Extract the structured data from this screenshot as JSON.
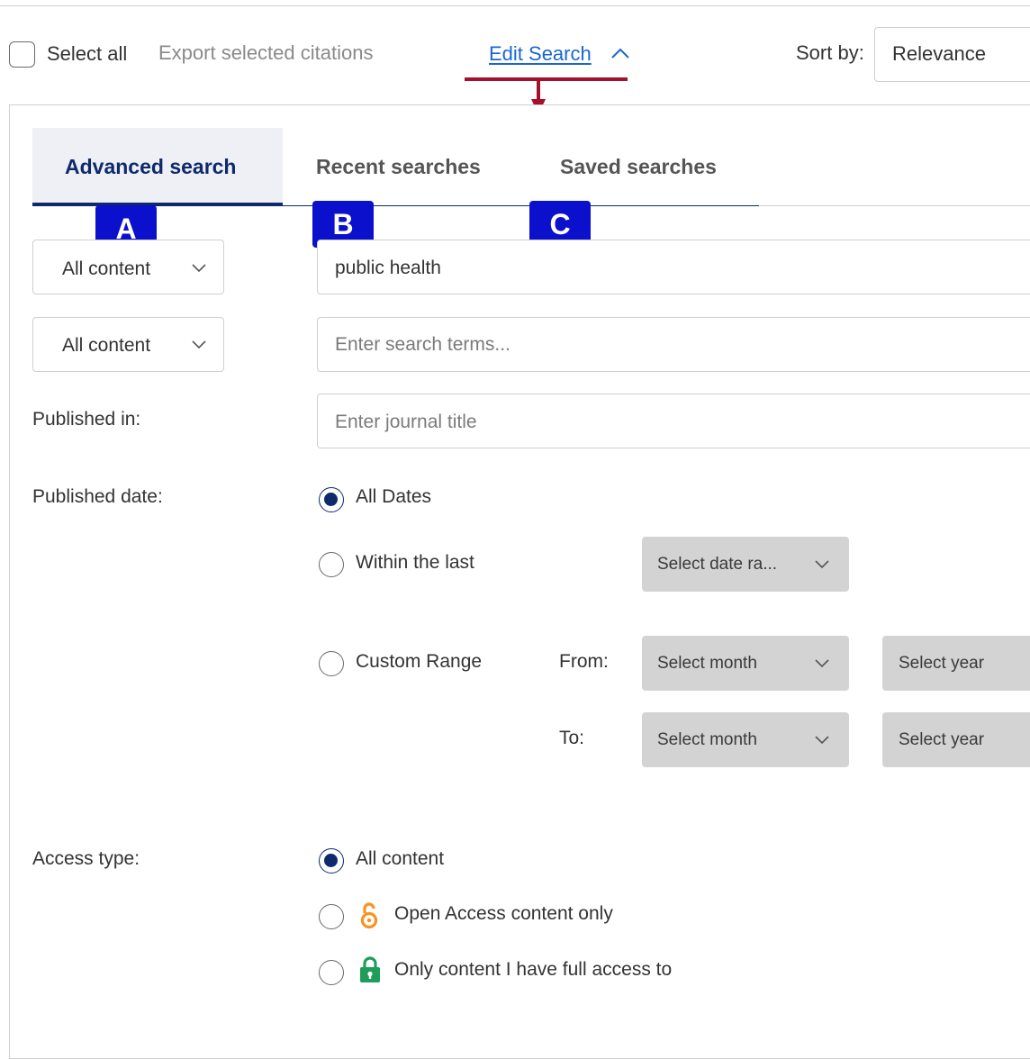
{
  "toolbar": {
    "select_all_label": "Select all",
    "export_label": "Export selected citations",
    "edit_search_label": "Edit Search",
    "sort_label": "Sort by:",
    "sort_value": "Relevance"
  },
  "tabs": [
    {
      "label": "Advanced search",
      "active": true,
      "badge": "A"
    },
    {
      "label": "Recent searches",
      "active": false,
      "badge": "B"
    },
    {
      "label": "Saved searches",
      "active": false,
      "badge": "C"
    }
  ],
  "search_rows": [
    {
      "field": "All content",
      "value": "public health",
      "placeholder": ""
    },
    {
      "field": "All content",
      "value": "",
      "placeholder": "Enter search terms..."
    }
  ],
  "published_in": {
    "label": "Published in:",
    "placeholder": "Enter journal title"
  },
  "published_date": {
    "label": "Published date:",
    "options": [
      "All Dates",
      "Within the last",
      "Custom Range"
    ],
    "selected": "All Dates",
    "date_range_placeholder": "Select date ra...",
    "from_label": "From:",
    "to_label": "To:",
    "month_placeholder": "Select month",
    "year_placeholder": "Select year"
  },
  "access_type": {
    "label": "Access type:",
    "options": [
      "All content",
      "Open Access content only",
      "Only content I have full access to"
    ],
    "selected": "All content"
  },
  "colors": {
    "accent_navy": "#0e2a6b",
    "link_blue": "#1a66d4",
    "annotation_red": "#a3112c",
    "badge_blue": "#0a10cc",
    "open_access_orange": "#f7931e",
    "lock_green": "#1e9e5a"
  },
  "icons": [
    "chevron-up-icon",
    "chevron-down-icon",
    "open-access-icon",
    "lock-icon"
  ]
}
